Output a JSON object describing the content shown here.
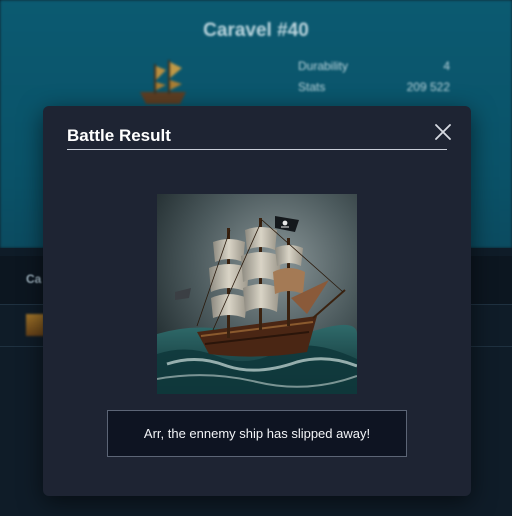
{
  "background": {
    "title": "Caravel #40",
    "stats": [
      {
        "label": "Durability",
        "value": "4"
      },
      {
        "label": "Stats",
        "value": "209 522"
      }
    ],
    "table_header": "Ca"
  },
  "modal": {
    "title": "Battle Result",
    "close_icon": "close-icon",
    "image_alt": "pirate ship sailing in a storm",
    "message": "Arr, the ennemy ship has slipped away!"
  },
  "colors": {
    "modal_bg": "#1e2433",
    "header_bg": "#0b5a71",
    "message_bg": "#0e1422"
  }
}
